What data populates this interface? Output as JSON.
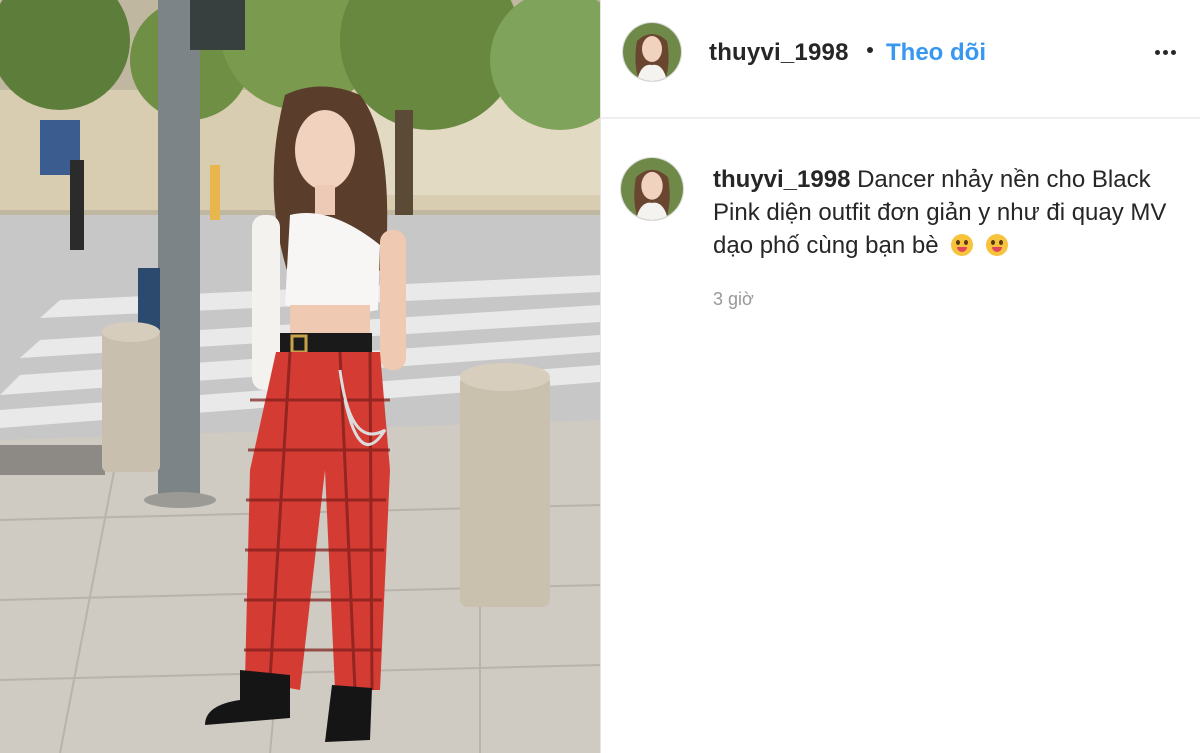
{
  "post": {
    "username": "thuyvi_1998",
    "follow_label": "Theo dõi",
    "more_icon": "more-options-icon"
  },
  "comment": {
    "username": "thuyvi_1998",
    "text": "Dancer nhảy nền cho Black Pink diện outfit đơn giản y như đi quay MV dạo phố cùng bạn bè",
    "emojis": [
      "winking-tongue-emoji",
      "tongue-out-emoji"
    ],
    "time": "3 giờ"
  },
  "colors": {
    "follow_blue": "#3897f0",
    "text_dark": "#262626",
    "muted_gray": "#999999"
  }
}
